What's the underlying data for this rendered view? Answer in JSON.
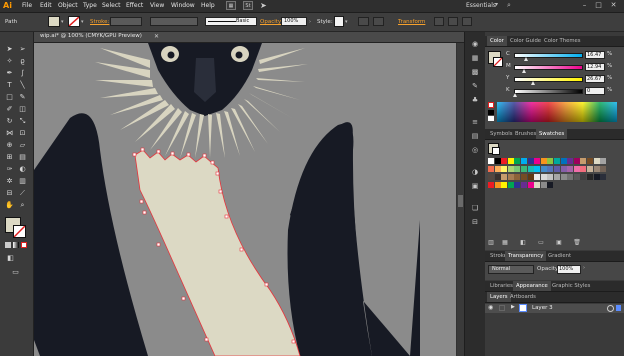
{
  "app": {
    "logo": "Ai",
    "workspace": "Essentials",
    "menus": [
      "File",
      "Edit",
      "Object",
      "Type",
      "Select",
      "Effect",
      "View",
      "Window",
      "Help"
    ]
  },
  "control_bar": {
    "selection": "Path",
    "stroke_label": "Stroke:",
    "brush_label": "Basic",
    "opacity_label": "Opacity:",
    "opacity_value": "100%",
    "style_label": "Style:",
    "transform_label": "Transform",
    "fill_color": "#dcd9c4"
  },
  "document": {
    "tab_title": "wip.ai* @ 100% (CMYK/GPU Preview)"
  },
  "color_panel": {
    "tabs": [
      "Color",
      "Color Guide",
      "Color Themes"
    ],
    "sliders": [
      {
        "label": "C",
        "value": "16.47"
      },
      {
        "label": "M",
        "value": "12.94"
      },
      {
        "label": "Y",
        "value": "26.67"
      },
      {
        "label": "K",
        "value": "0"
      }
    ],
    "unit": "%"
  },
  "swatches_panel": {
    "tabs": [
      "Symbols",
      "Brushes",
      "Swatches"
    ]
  },
  "transparency_panel": {
    "tabs": [
      "Stroke",
      "Transparency",
      "Gradient"
    ],
    "blend_mode": "Normal",
    "opacity_label": "Opacity:",
    "opacity_value": "100%"
  },
  "appearance_panel": {
    "tabs": [
      "Libraries",
      "Appearance",
      "Graphic Styles"
    ]
  },
  "layers_panel": {
    "tabs": [
      "Layers",
      "Artboards"
    ],
    "layers": [
      {
        "name": "Layer 3"
      }
    ]
  },
  "colors": {
    "accent": "#f7a12c",
    "canvas": "#8b8b8b",
    "artwork_cream": "#dcd9c4",
    "artwork_dark": "#171a24",
    "selection_red": "#e8333b"
  }
}
